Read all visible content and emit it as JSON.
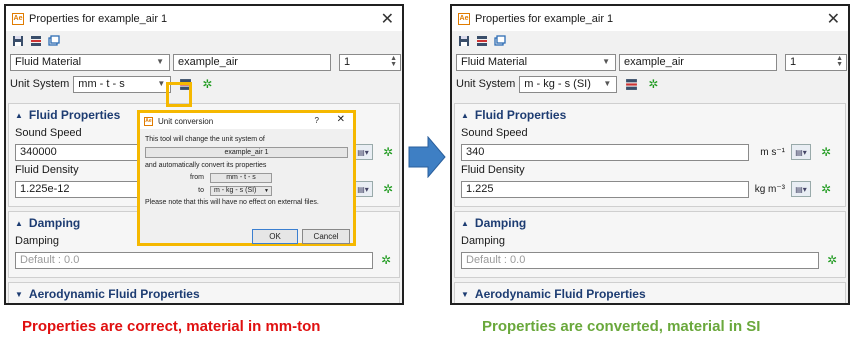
{
  "left": {
    "title": "Properties for example_air 1",
    "material_type": "Fluid Material",
    "material_name": "example_air",
    "material_id": "1",
    "unit_system_label": "Unit System",
    "unit_system_value": "mm - t - s",
    "fluid_section": "Fluid Properties",
    "sound_speed_label": "Sound Speed",
    "sound_speed_value": "340000",
    "density_label": "Fluid Density",
    "density_value": "1.225e-12",
    "damping_section": "Damping",
    "damping_label": "Damping",
    "damping_placeholder": "Default : 0.0",
    "aero_section": "Aerodynamic Fluid Properties"
  },
  "popup": {
    "title": "Unit conversion",
    "question": "?",
    "line1": "This tool will change the unit system of",
    "material": "example_air 1",
    "line2": "and automatically convert its properties",
    "from_label": "from",
    "from_value": "mm - t - s",
    "to_label": "to",
    "to_value": "m - kg - s (SI)",
    "note": "Please note that this will have no effect on external files.",
    "ok_label": "OK",
    "cancel_label": "Cancel"
  },
  "right": {
    "title": "Properties for example_air 1",
    "material_type": "Fluid Material",
    "material_name": "example_air",
    "material_id": "1",
    "unit_system_label": "Unit System",
    "unit_system_value": "m - kg - s (SI)",
    "fluid_section": "Fluid Properties",
    "sound_speed_label": "Sound Speed",
    "sound_speed_value": "340",
    "sound_speed_unit": "m s⁻¹",
    "density_label": "Fluid Density",
    "density_value": "1.225",
    "density_unit": "kg m⁻³",
    "damping_section": "Damping",
    "damping_label": "Damping",
    "damping_placeholder": "Default : 0.0",
    "aero_section": "Aerodynamic Fluid Properties"
  },
  "captions": {
    "left": "Properties are correct, material in mm-ton",
    "right": "Properties are converted, material in SI"
  },
  "colors": {
    "left_caption": "#e01010",
    "right_caption": "#6aa83c",
    "highlight": "#f5b800",
    "arrow": "#3e7fc4",
    "section_heading": "#1d3c72"
  }
}
